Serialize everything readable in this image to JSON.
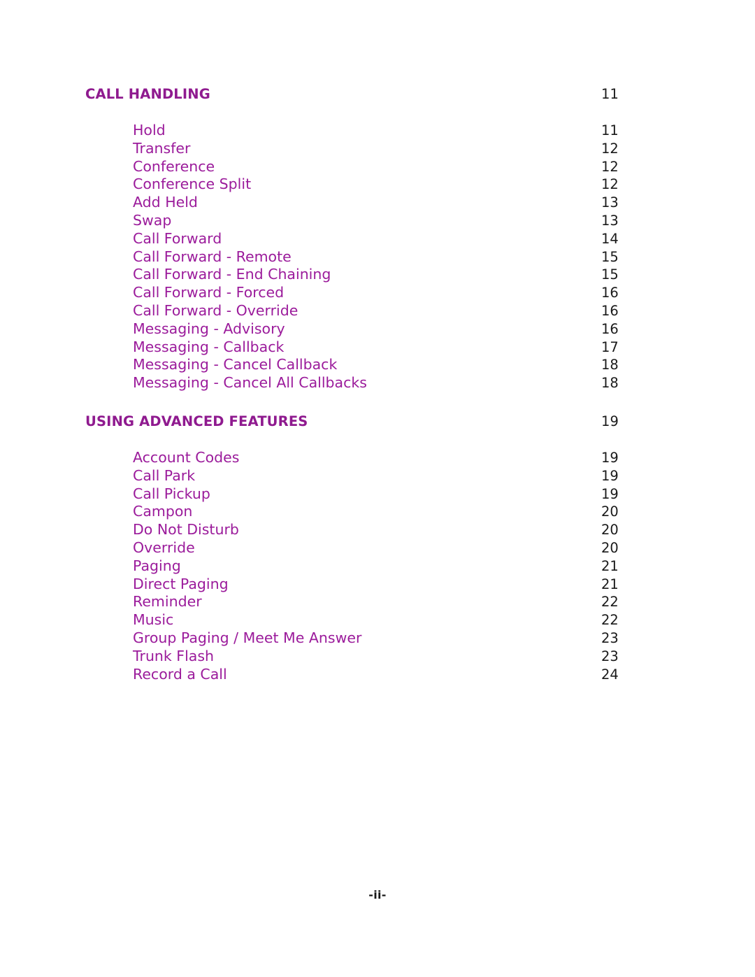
{
  "document": {
    "footer_label": "-ii-",
    "colors": {
      "heading": "#8f1a8f",
      "entry": "#9b1b9b",
      "page_number": "#1a1a1a",
      "background": "#ffffff"
    }
  },
  "toc": {
    "sections": [
      {
        "heading": "CALL HANDLING",
        "heading_page": "11",
        "entries": [
          {
            "title": "Hold",
            "page": "11"
          },
          {
            "title": "Transfer",
            "page": "12"
          },
          {
            "title": "Conference",
            "page": "12"
          },
          {
            "title": "Conference Split",
            "page": "12"
          },
          {
            "title": "Add Held",
            "page": "13"
          },
          {
            "title": "Swap",
            "page": "13"
          },
          {
            "title": "Call Forward",
            "page": "14"
          },
          {
            "title": "Call Forward - Remote",
            "page": "15"
          },
          {
            "title": "Call Forward - End Chaining",
            "page": "15"
          },
          {
            "title": "Call Forward - Forced",
            "page": "16"
          },
          {
            "title": "Call Forward - Override",
            "page": "16"
          },
          {
            "title": "Messaging - Advisory",
            "page": "16"
          },
          {
            "title": "Messaging - Callback",
            "page": "17"
          },
          {
            "title": "Messaging - Cancel Callback",
            "page": "18"
          },
          {
            "title": "Messaging - Cancel All Callbacks",
            "page": "18"
          }
        ]
      },
      {
        "heading": "USING ADVANCED FEATURES",
        "heading_page": "19",
        "entries": [
          {
            "title": "Account Codes",
            "page": "19"
          },
          {
            "title": "Call Park",
            "page": "19"
          },
          {
            "title": "Call Pickup",
            "page": "19"
          },
          {
            "title": "Campon",
            "page": "20"
          },
          {
            "title": "Do Not Disturb",
            "page": "20"
          },
          {
            "title": "Override",
            "page": "20"
          },
          {
            "title": "Paging",
            "page": "21"
          },
          {
            "title": "Direct Paging",
            "page": "21"
          },
          {
            "title": "Reminder",
            "page": "22"
          },
          {
            "title": "Music",
            "page": "22"
          },
          {
            "title": "Group Paging / Meet Me Answer",
            "page": "23"
          },
          {
            "title": "Trunk Flash",
            "page": "23"
          },
          {
            "title": "Record a Call",
            "page": "24"
          }
        ]
      }
    ]
  }
}
